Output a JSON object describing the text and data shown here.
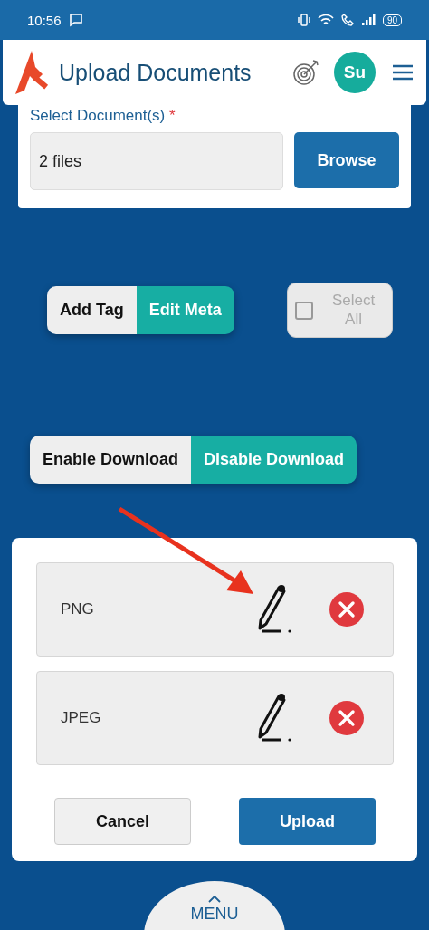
{
  "status_bar": {
    "time": "10:56",
    "battery": "90"
  },
  "header": {
    "title": "Upload Documents",
    "avatar": "Su"
  },
  "upload": {
    "label": "Select Document(s)",
    "required_mark": "*",
    "value": "2 files",
    "browse": "Browse"
  },
  "tag_toggle": [
    {
      "label": "Add Tag",
      "selected": false
    },
    {
      "label": "Edit Meta",
      "selected": true
    }
  ],
  "select_all": {
    "label": "Select All",
    "checked": false,
    "disabled": true
  },
  "download_toggle": [
    {
      "label": "Enable Download",
      "selected": false
    },
    {
      "label": "Disable Download",
      "selected": true
    }
  ],
  "files": [
    {
      "name": "PNG"
    },
    {
      "name": "JPEG"
    }
  ],
  "actions": [
    {
      "label": "Cancel",
      "kind": "secondary"
    },
    {
      "label": "Upload",
      "kind": "primary"
    }
  ],
  "menu": {
    "label": "MENU"
  }
}
